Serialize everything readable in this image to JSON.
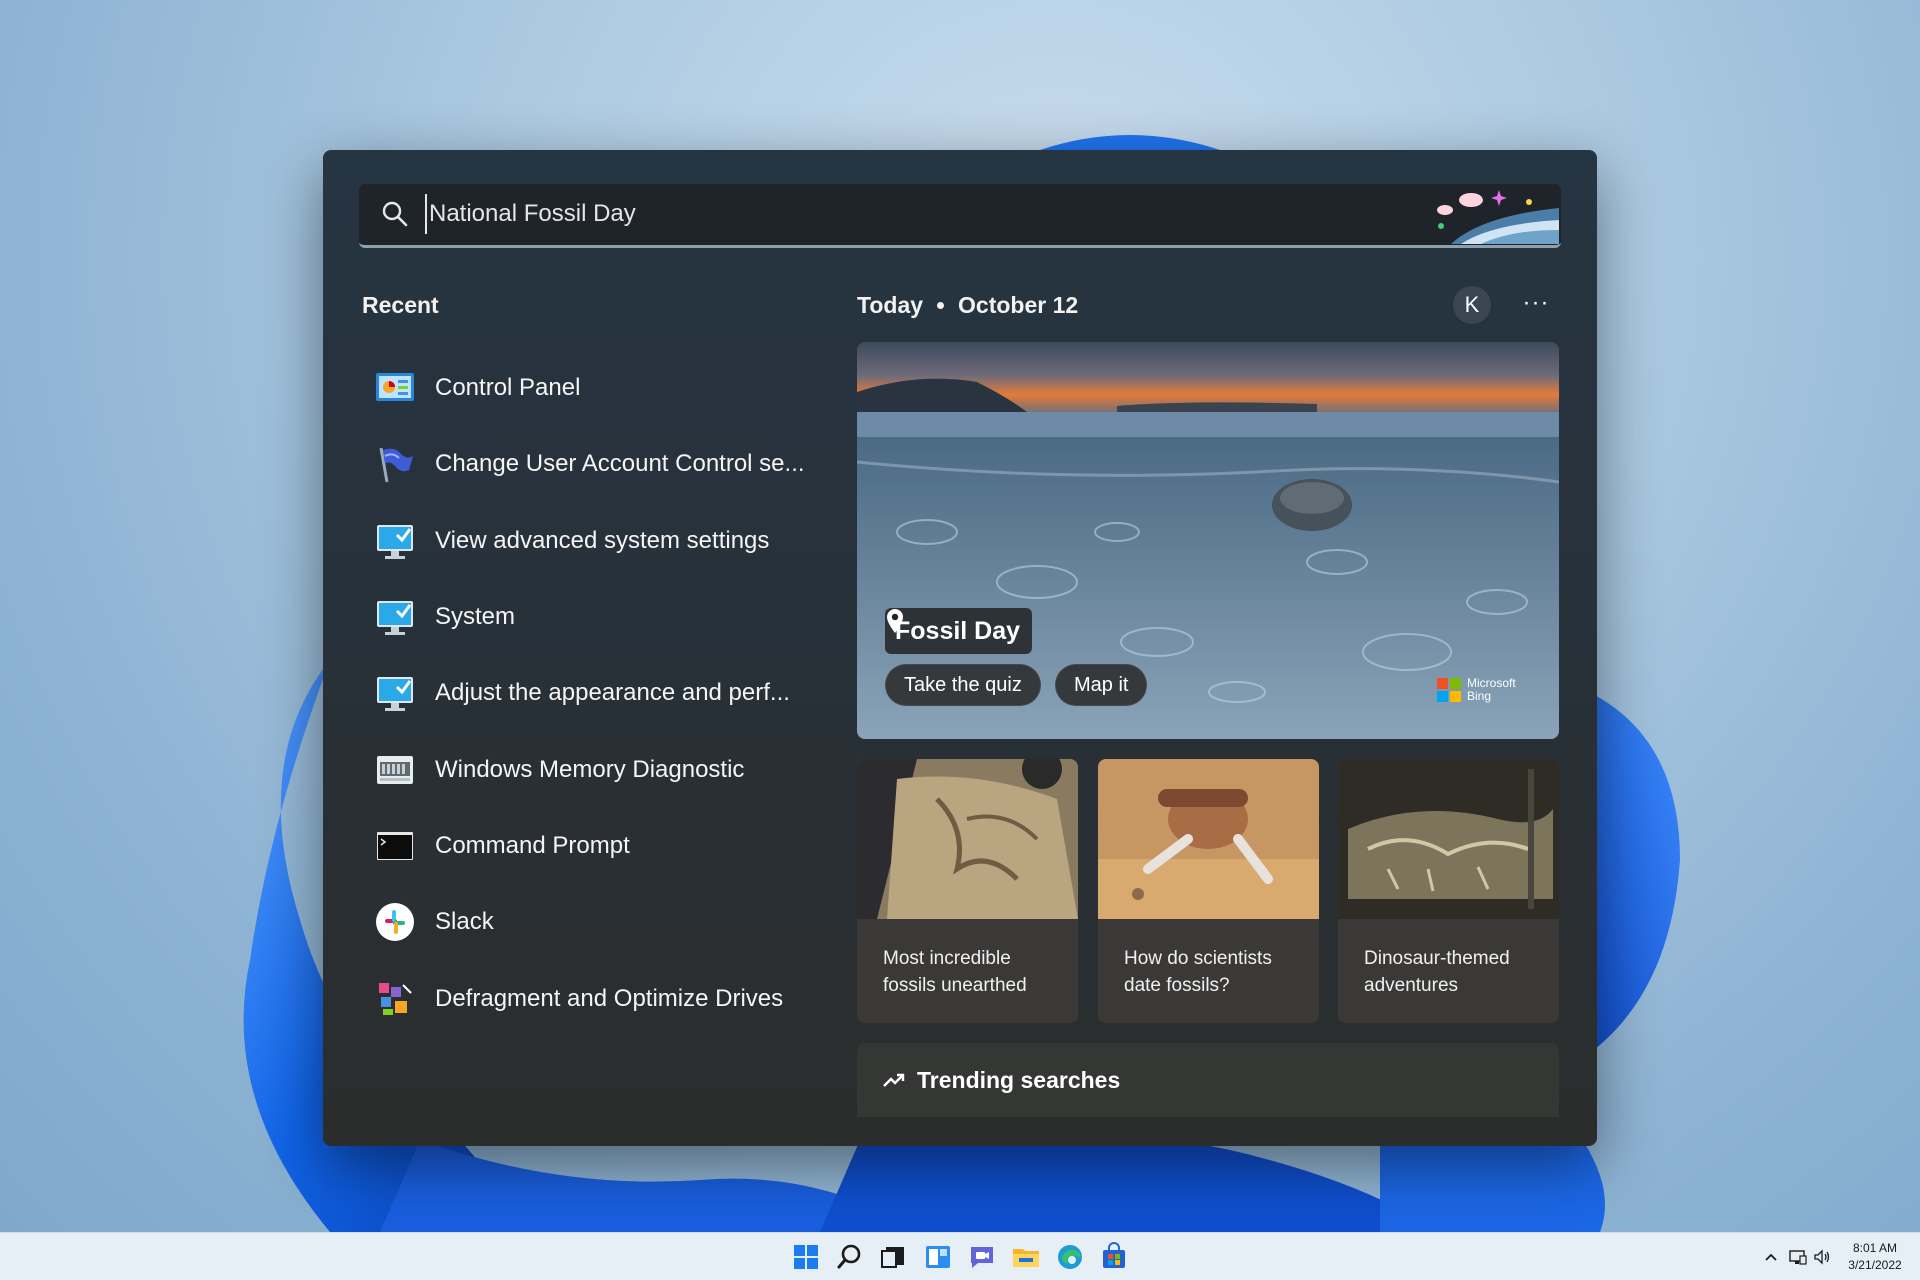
{
  "search": {
    "value": "National Fossil Day",
    "icon": "search-icon"
  },
  "recent": {
    "title": "Recent",
    "items": [
      {
        "label": "Control Panel",
        "icon": "control-panel-icon"
      },
      {
        "label": "Change User Account Control se...",
        "icon": "uac-flag-icon"
      },
      {
        "label": "View advanced system settings",
        "icon": "monitor-check-icon"
      },
      {
        "label": "System",
        "icon": "monitor-check-icon"
      },
      {
        "label": "Adjust the appearance and perf...",
        "icon": "monitor-check-icon"
      },
      {
        "label": "Windows Memory Diagnostic",
        "icon": "memory-chip-icon"
      },
      {
        "label": "Command Prompt",
        "icon": "terminal-icon"
      },
      {
        "label": "Slack",
        "icon": "slack-icon"
      },
      {
        "label": "Defragment and Optimize Drives",
        "icon": "defrag-icon"
      }
    ]
  },
  "today": {
    "label": "Today",
    "date": "October 12",
    "avatar_initial": "K",
    "more": "···"
  },
  "hero": {
    "tag": "Fossil Day",
    "buttons": [
      "Take the quiz",
      "Map it"
    ],
    "brand_line1": "Microsoft",
    "brand_line2": "Bing"
  },
  "cards": [
    {
      "text": "Most incredible fossils unearthed"
    },
    {
      "text": "How do scientists date fossils?"
    },
    {
      "text": "Dinosaur-themed adventures"
    }
  ],
  "trending": {
    "label": "Trending searches"
  },
  "taskbar": {
    "icons": [
      "start-icon",
      "search-icon",
      "task-view-icon",
      "widgets-icon",
      "chat-icon",
      "file-explorer-icon",
      "edge-icon",
      "store-icon"
    ],
    "clock_time": "8:01 AM",
    "clock_date": "3/21/2022"
  },
  "colors": {
    "panel_bg": "#27313a",
    "accent_blue": "#0a5ad6",
    "taskbar_bg": "#e6eef6"
  }
}
